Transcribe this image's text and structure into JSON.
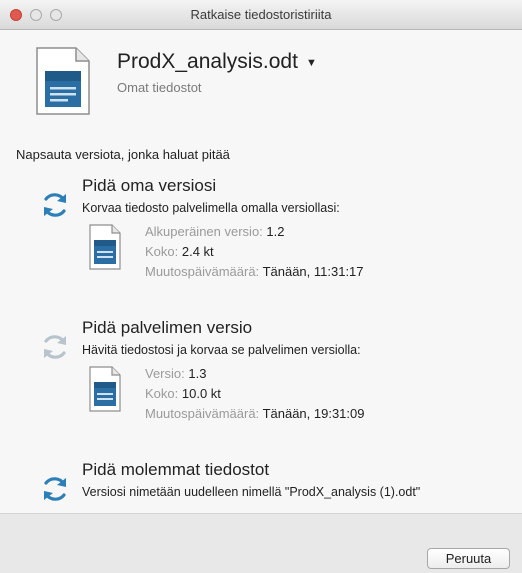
{
  "window": {
    "title": "Ratkaise tiedostoristiriita"
  },
  "file": {
    "name": "ProdX_analysis.odt",
    "location": "Omat tiedostot",
    "icon": "document-icon"
  },
  "instruction": "Napsauta versiota, jonka haluat pitää",
  "options": [
    {
      "title": "Pidä oma versiosi",
      "description": "Korvaa tiedosto palvelimella omalla versiollasi:",
      "icon": "sync-icon",
      "details": [
        {
          "label": "Alkuperäinen versio:",
          "value": "1.2"
        },
        {
          "label": "Koko:",
          "value": "2.4 kt"
        },
        {
          "label": "Muutospäivämäärä:",
          "value": "Tänään, 11:31:17"
        }
      ]
    },
    {
      "title": "Pidä palvelimen versio",
      "description": "Hävitä tiedostosi ja korvaa se palvelimen versiolla:",
      "icon": "sync-icon-dim",
      "details": [
        {
          "label": "Versio:",
          "value": "1.3"
        },
        {
          "label": "Koko:",
          "value": "10.0 kt"
        },
        {
          "label": "Muutospäivämäärä:",
          "value": "Tänään, 19:31:09"
        }
      ]
    },
    {
      "title": "Pidä molemmat tiedostot",
      "description": "Versiosi nimetään uudelleen nimellä \"ProdX_analysis (1).odt\"",
      "icon": "sync-icon"
    }
  ],
  "footer": {
    "cancel_label": "Peruuta"
  },
  "colors": {
    "accent": "#2d7fb8",
    "icon_dim": "#b8c4cc",
    "close": "#e05a4f"
  }
}
